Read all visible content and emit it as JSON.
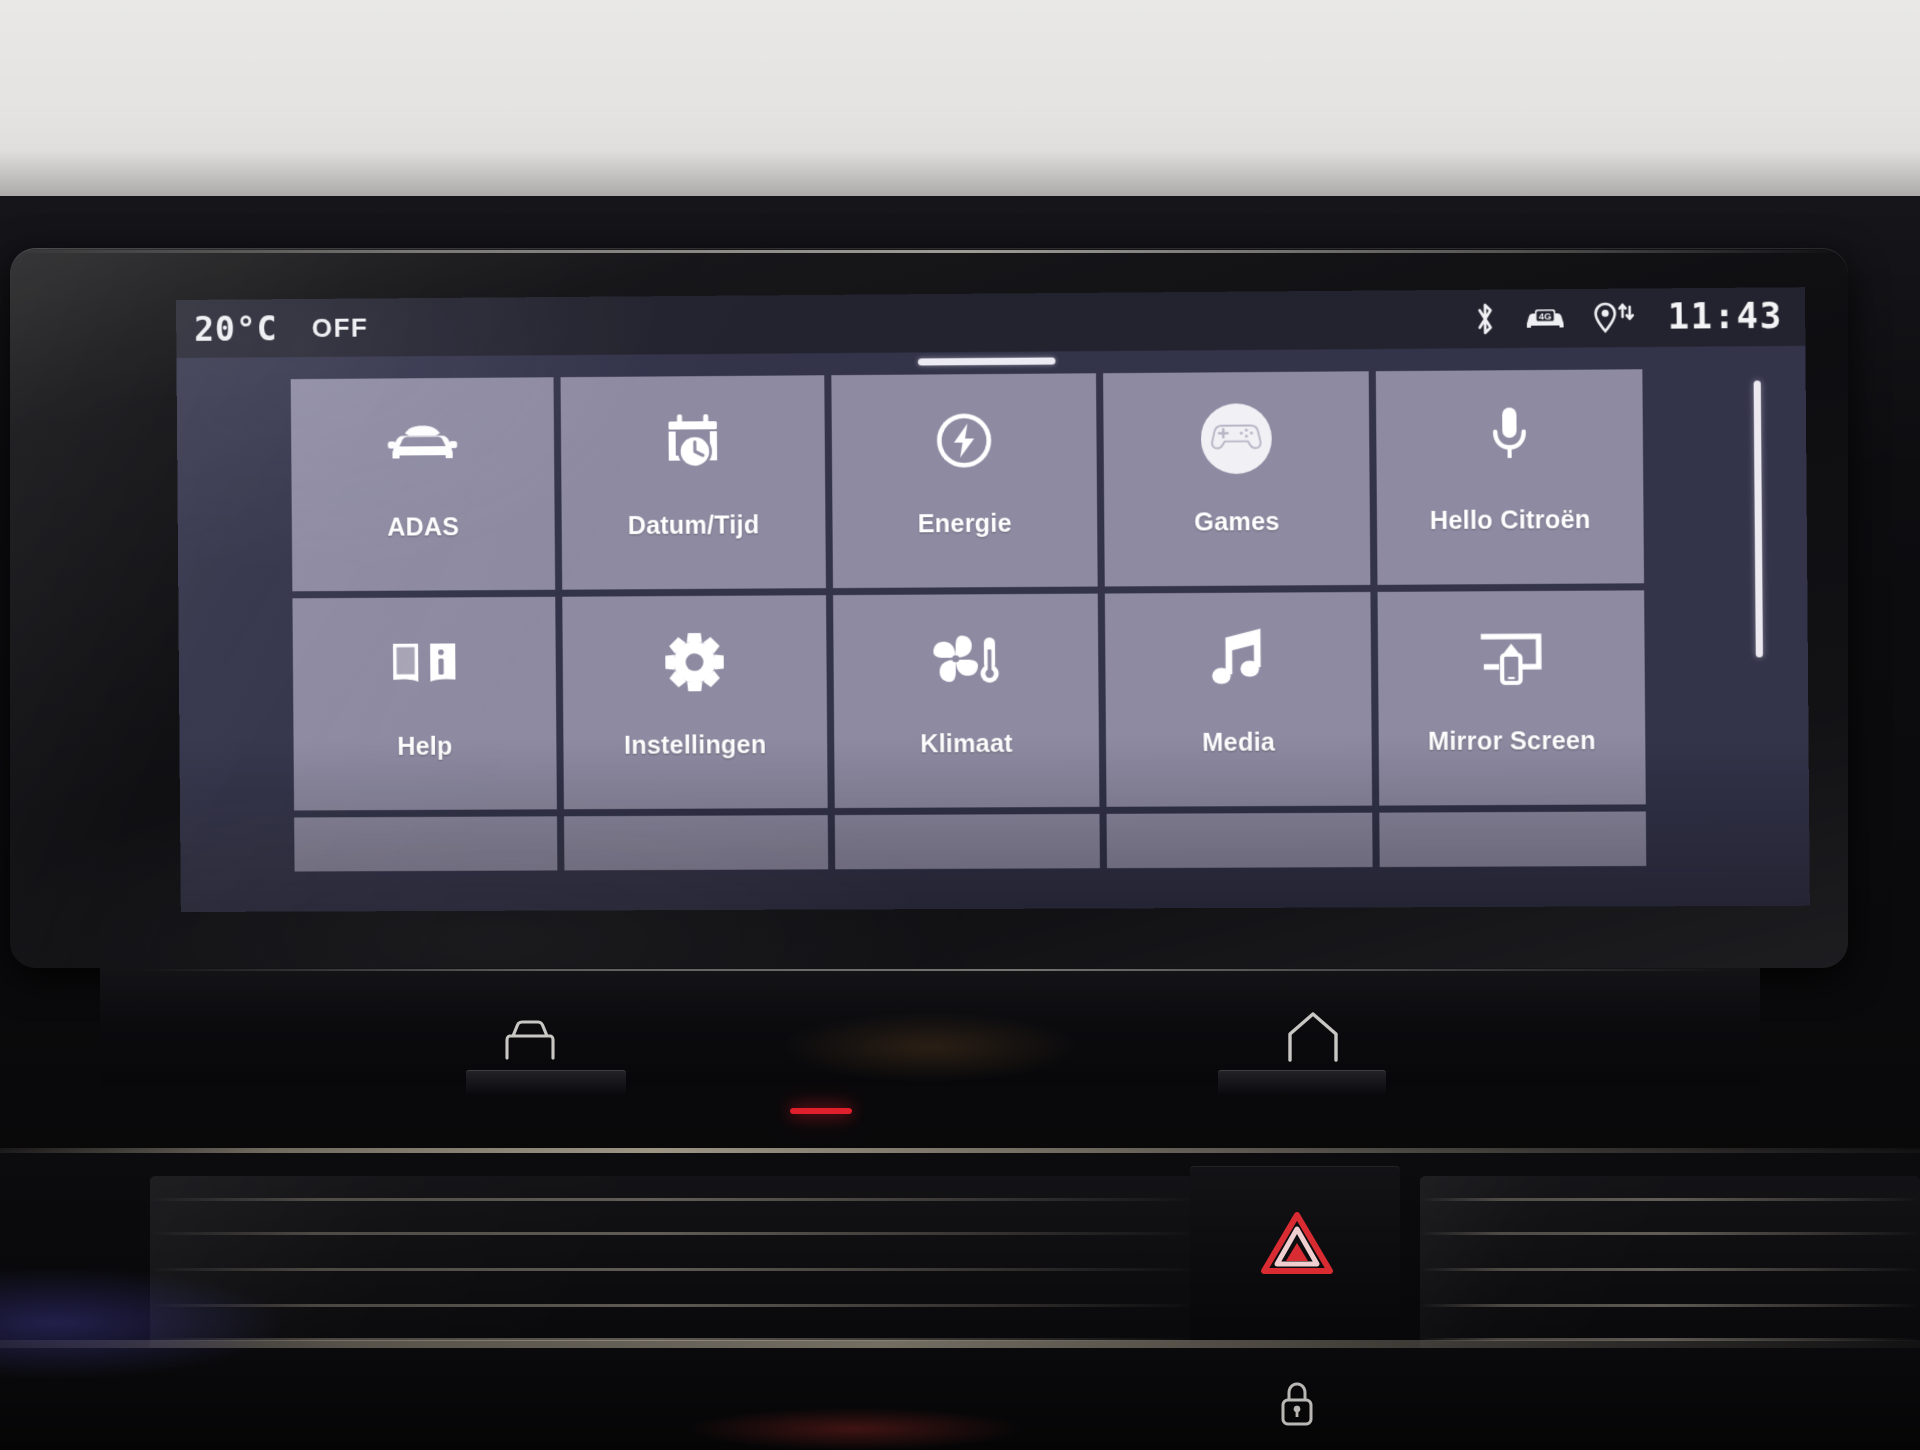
{
  "screen": {
    "status_bar": {
      "temperature": "20°C",
      "fan_state": "OFF",
      "bluetooth_icon": "bluetooth-icon",
      "network_icon": "car-4g-icon",
      "network_label": "4G",
      "location_icon": "location-pin-data-transfer-icon",
      "clock": "11:43"
    },
    "page_indicator": "page-indicator-bar",
    "apps": [
      {
        "label": "ADAS",
        "icon": "car-icon"
      },
      {
        "label": "Datum/Tijd",
        "icon": "calendar-clock-icon"
      },
      {
        "label": "Energie",
        "icon": "energy-bolt-icon"
      },
      {
        "label": "Games",
        "icon": "gamepad-icon"
      },
      {
        "label": "Hello Citroën",
        "icon": "microphone-icon"
      },
      {
        "label": "Help",
        "icon": "book-info-icon"
      },
      {
        "label": "Instellingen",
        "icon": "gear-icon"
      },
      {
        "label": "Klimaat",
        "icon": "fan-thermometer-icon"
      },
      {
        "label": "Media",
        "icon": "music-note-icon"
      },
      {
        "label": "Mirror Screen",
        "icon": "screen-mirror-icon"
      }
    ],
    "scrollbar": "vertical-scrollbar"
  },
  "hardware": {
    "keys": [
      {
        "name": "vehicle-settings-key",
        "icon": "car-front-icon"
      },
      {
        "name": "home-key",
        "icon": "home-icon"
      }
    ],
    "hazard_button": {
      "icon": "hazard-triangle-icon",
      "color": "#d92b32"
    },
    "lock_button": {
      "icon": "door-lock-icon"
    }
  },
  "colors": {
    "tile": "#8e8aa2",
    "screen_bg": "#33334a",
    "status_bar_bg": "#23232f",
    "text": "#ffffff",
    "accent": "#ece9f1",
    "hazard_red": "#d92b32"
  }
}
